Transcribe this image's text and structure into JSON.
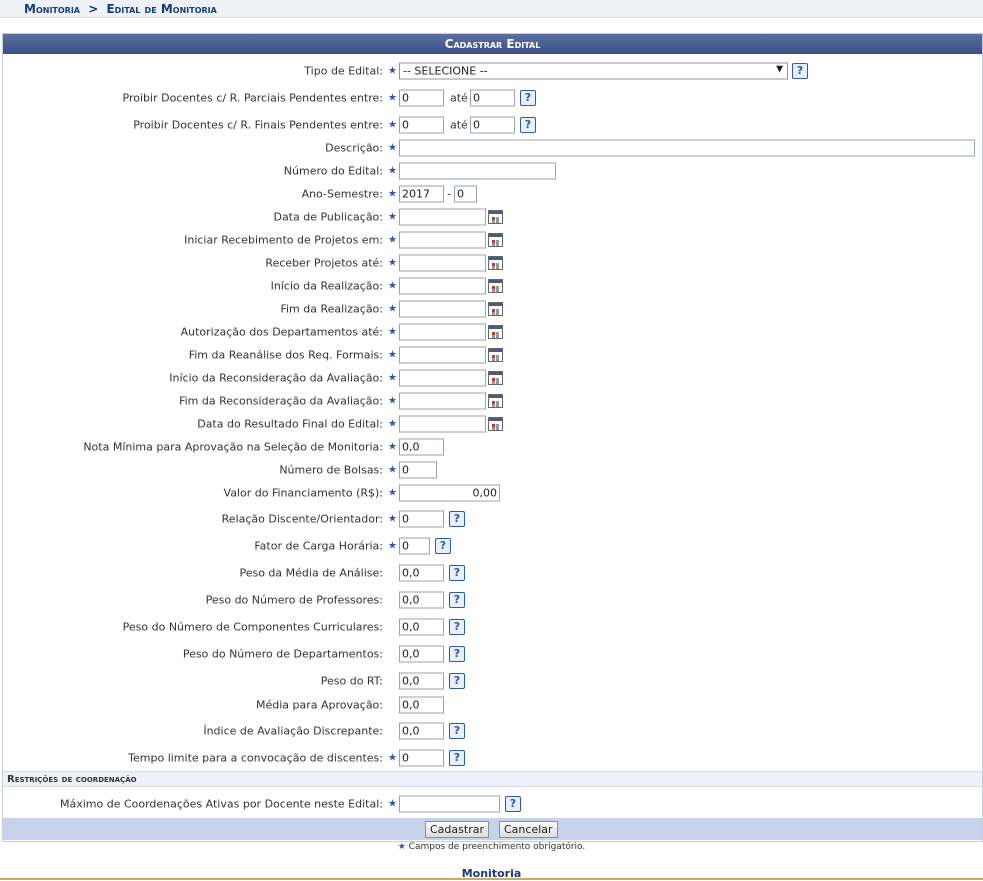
{
  "breadcrumb": {
    "part1": "Monitoria",
    "sep": ">",
    "part2": "Edital de Monitoria"
  },
  "form": {
    "title": "Cadastrar Edital",
    "tipo_edital": {
      "label": "Tipo de Edital:",
      "value": "-- SELECIONE --"
    },
    "proibir_parciais": {
      "label": "Proibir Docentes c/ R. Parciais Pendentes entre:",
      "from": "0",
      "ate": "até",
      "to": "0"
    },
    "proibir_finais": {
      "label": "Proibir Docentes c/ R. Finais Pendentes entre:",
      "from": "0",
      "ate": "até",
      "to": "0"
    },
    "descricao": {
      "label": "Descrição:",
      "value": ""
    },
    "numero_edital": {
      "label": "Número do Edital:",
      "value": ""
    },
    "ano_semestre": {
      "label": "Ano-Semestre:",
      "ano": "2017",
      "sep": "-",
      "semestre": "0"
    },
    "datas": [
      {
        "label": "Data de Publicação:"
      },
      {
        "label": "Iniciar Recebimento de Projetos em:"
      },
      {
        "label": "Receber Projetos até:"
      },
      {
        "label": "Início da Realização:"
      },
      {
        "label": "Fim da Realização:"
      },
      {
        "label": "Autorização dos Departamentos até:"
      },
      {
        "label": "Fim da Reanálise dos Req. Formais:"
      },
      {
        "label": "Início da Reconsideração da Avaliação:"
      },
      {
        "label": "Fim da Reconsideração da Avaliação:"
      },
      {
        "label": "Data do Resultado Final do Edital:"
      }
    ],
    "nota_minima": {
      "label": "Nota Mínima para Aprovação na Seleção de Monitoria:",
      "value": "0,0"
    },
    "numero_bolsas": {
      "label": "Número de Bolsas:",
      "value": "0"
    },
    "valor_financiamento": {
      "label": "Valor do Financiamento (R$):",
      "value": "0,00"
    },
    "relacao": {
      "label": "Relação Discente/Orientador:",
      "value": "0"
    },
    "fator_carga": {
      "label": "Fator de Carga Horária:",
      "value": "0"
    },
    "peso_media": {
      "label": "Peso da Média de Análise:",
      "value": "0,0"
    },
    "peso_professores": {
      "label": "Peso do Número de Professores:",
      "value": "0,0"
    },
    "peso_componentes": {
      "label": "Peso do Número de Componentes Curriculares:",
      "value": "0,0"
    },
    "peso_departamentos": {
      "label": "Peso do Número de Departamentos:",
      "value": "0,0"
    },
    "peso_rt": {
      "label": "Peso do RT:",
      "value": "0,0"
    },
    "media_aprovacao": {
      "label": "Média para Aprovação:",
      "value": "0,0"
    },
    "indice_discrepante": {
      "label": "Índice de Avaliação Discrepante:",
      "value": "0,0"
    },
    "tempo_limite": {
      "label": "Tempo limite para a convocação de discentes:",
      "value": "0"
    },
    "section_coordenacao": "Restrições de coordenação",
    "maximo_coordenacoes": {
      "label": "Máximo de Coordenações Ativas por Docente neste Edital:",
      "value": ""
    },
    "buttons": {
      "cadastrar": "Cadastrar",
      "cancelar": "Cancelar"
    },
    "required_note": "Campos de preenchimento obrigatório."
  },
  "footer": {
    "title": "Monitoria"
  },
  "icons": {
    "required": "star-icon",
    "help": "help-icon",
    "calendar": "calendar-icon",
    "dropdown": "chevron-down-icon"
  },
  "colors": {
    "header": "#3a5088",
    "link": "#163b78",
    "required_star": "#2b5aa8",
    "button_bar": "#c7d3ea"
  }
}
